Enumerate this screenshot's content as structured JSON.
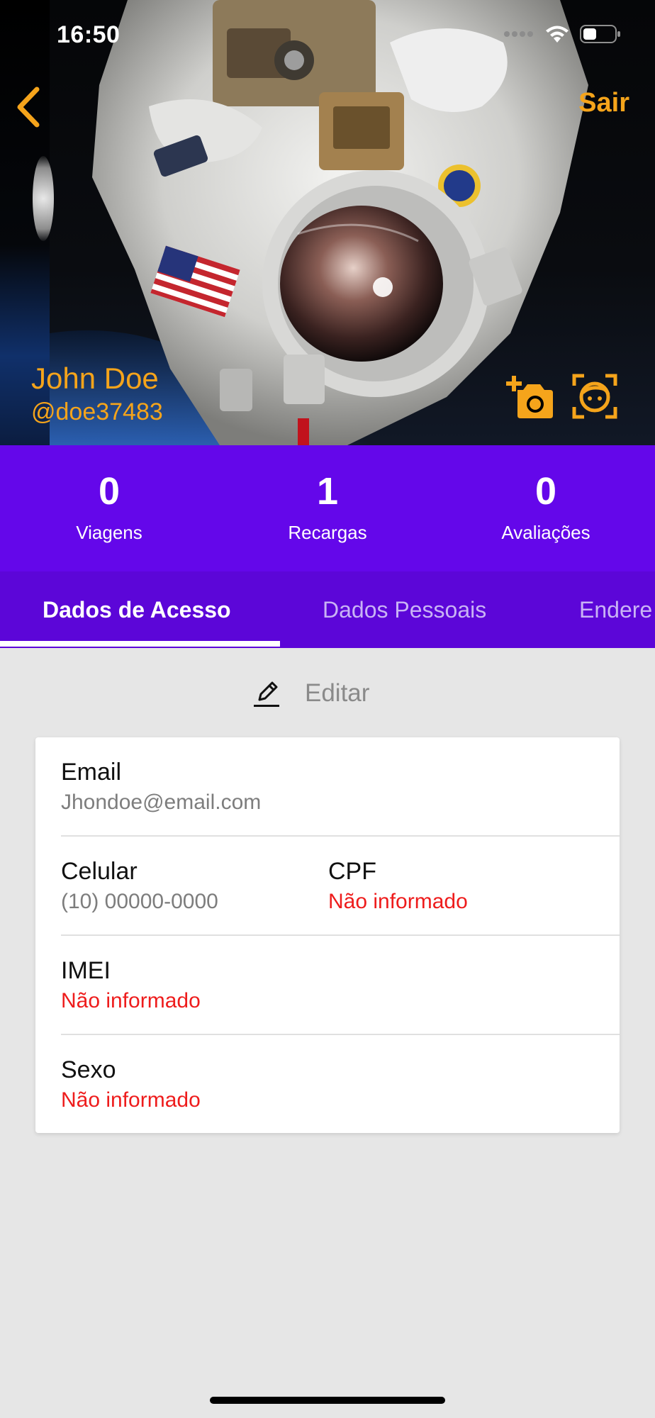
{
  "status_bar": {
    "time": "16:50"
  },
  "header": {
    "exit_label": "Sair"
  },
  "profile": {
    "name": "John Doe",
    "handle": "@doe37483"
  },
  "stats": [
    {
      "value": "0",
      "label": "Viagens"
    },
    {
      "value": "1",
      "label": "Recargas"
    },
    {
      "value": "0",
      "label": "Avaliações"
    }
  ],
  "tabs": [
    {
      "label": "Dados de Acesso",
      "active": true
    },
    {
      "label": "Dados Pessoais",
      "active": false
    },
    {
      "label": "Endere",
      "active": false
    }
  ],
  "edit_label": "Editar",
  "fields": {
    "email": {
      "label": "Email",
      "value": "Jhondoe@email.com"
    },
    "celular": {
      "label": "Celular",
      "value": "(10) 00000-0000"
    },
    "cpf": {
      "label": "CPF",
      "value": "Não informado"
    },
    "imei": {
      "label": "IMEI",
      "value": "Não informado"
    },
    "sexo": {
      "label": "Sexo",
      "value": "Não informado"
    }
  },
  "colors": {
    "accent_orange": "#f5a41b",
    "stats_purple": "#6407ea",
    "tabs_purple": "#5c06d8",
    "not_informed_red": "#ee1c1c",
    "background": "#e6e6e6"
  },
  "icons": [
    "back-chevron-icon",
    "add-photo-icon",
    "face-detection-icon",
    "pencil-icon",
    "signal-icon",
    "wifi-icon",
    "battery-icon"
  ]
}
